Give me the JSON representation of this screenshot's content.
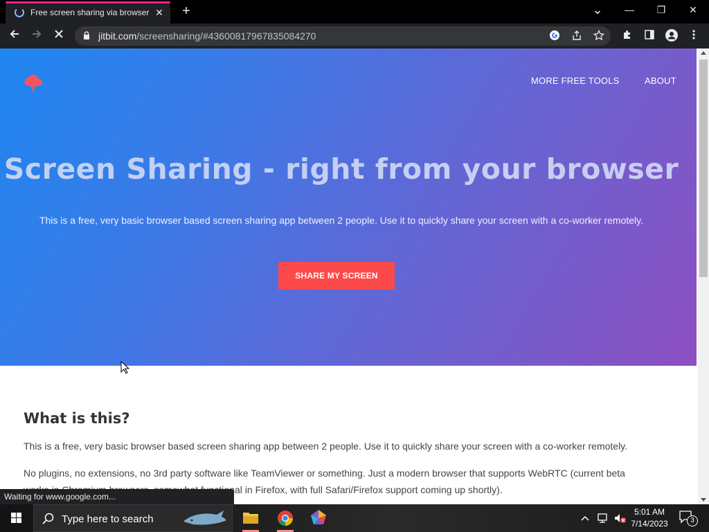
{
  "browser": {
    "tab_title": "Free screen sharing via browser",
    "tab_close": "✕",
    "new_tab": "+",
    "url_host": "jitbit.com",
    "url_path": "/screensharing/#4360081796783508427​0",
    "status_text": "Waiting for www.google.com..."
  },
  "window_controls": {
    "chevron": "⌄",
    "minimize": "—",
    "restore": "❐",
    "close": "✕"
  },
  "page": {
    "nav": {
      "tools": "MORE FREE TOOLS",
      "about": "ABOUT"
    },
    "hero_title": "Screen Sharing - right from your browser",
    "hero_subtitle": "This is a free, very basic browser based screen sharing app between 2 people. Use it to quickly share your screen with a co-worker remotely.",
    "share_button": "SHARE MY SCREEN",
    "section_title": "What is this?",
    "para1": "This is a free, very basic browser based screen sharing app between 2 people. Use it to quickly share your screen with a co-worker remotely.",
    "para2_line1": "No plugins, no extensions, no 3rd party software like TeamViewer or something. Just a modern browser that supports WebRTC (current beta",
    "para2_line2": "works in Chromium browsers, somewhat functional in Firefox, with full Safari/Firefox support coming up shortly)."
  },
  "taskbar": {
    "search_placeholder": "Type here to search",
    "time": "5:01 AM",
    "date": "7/14/2023",
    "notifications": "3"
  },
  "colors": {
    "hero_start": "#1e86f0",
    "hero_end": "#8d4fc0",
    "accent_button": "#fc4a4a",
    "logo": "#f2555f"
  }
}
